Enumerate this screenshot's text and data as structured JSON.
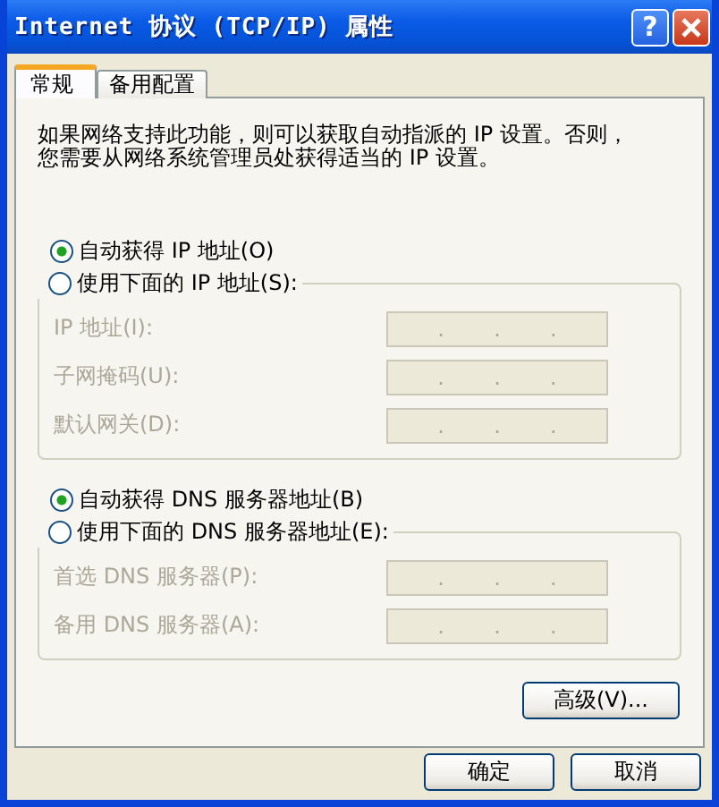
{
  "window": {
    "title": "Internet 协议 (TCP/IP) 属性",
    "help": "?"
  },
  "tabs": [
    {
      "label": "常规",
      "selected": true
    },
    {
      "label": "备用配置",
      "selected": false
    }
  ],
  "description": [
    "如果网络支持此功能，则可以获取自动指派的 IP 设置。否则，",
    "您需要从网络系统管理员处获得适当的 IP 设置。"
  ],
  "sections": [
    {
      "auto": {
        "text": "自动获得 IP 地址(O)",
        "selected": true
      },
      "manual": {
        "text": "使用下面的 IP 地址(S):",
        "selected": false
      },
      "fields": [
        {
          "label": "IP 地址(I):",
          "disabled": true,
          "dots": [
            ".",
            ".",
            "."
          ]
        },
        {
          "label": "子网掩码(U):",
          "disabled": true,
          "dots": [
            ".",
            ".",
            "."
          ]
        },
        {
          "label": "默认网关(D):",
          "disabled": true,
          "dots": [
            ".",
            ".",
            "."
          ]
        }
      ]
    },
    {
      "auto": {
        "text": "自动获得 DNS 服务器地址(B)",
        "selected": true
      },
      "manual": {
        "text": "使用下面的 DNS 服务器地址(E):",
        "selected": false
      },
      "fields": [
        {
          "label": "首选 DNS 服务器(P):",
          "disabled": true,
          "dots": [
            ".",
            ".",
            "."
          ]
        },
        {
          "label": "备用 DNS 服务器(A):",
          "disabled": true,
          "dots": [
            ".",
            ".",
            "."
          ]
        }
      ]
    }
  ],
  "advanced_button": "高级(V)...",
  "buttons": [
    "确定",
    "取消"
  ]
}
